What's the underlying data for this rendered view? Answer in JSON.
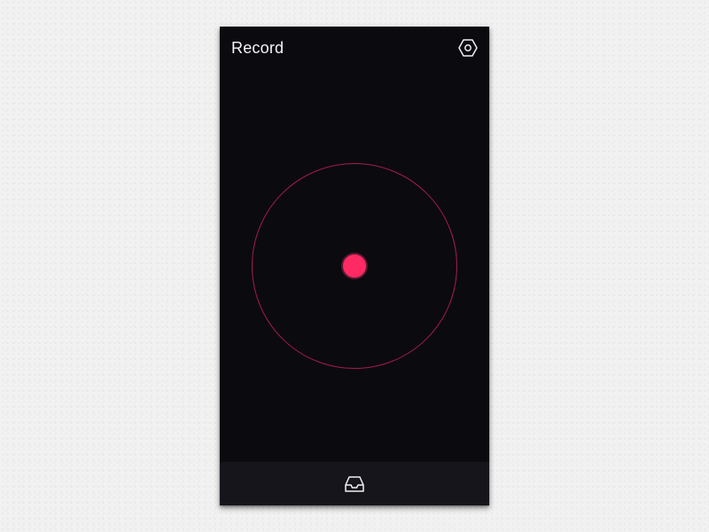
{
  "header": {
    "title": "Record",
    "settings_icon": "hexagon-gear-icon"
  },
  "recorder": {
    "ring_color": "#a51d4a",
    "button_color": "#fe2a63",
    "background_color": "#0b0a0f"
  },
  "bottom_bar": {
    "inbox_icon": "inbox-tray-icon",
    "background_color": "#16151b"
  }
}
